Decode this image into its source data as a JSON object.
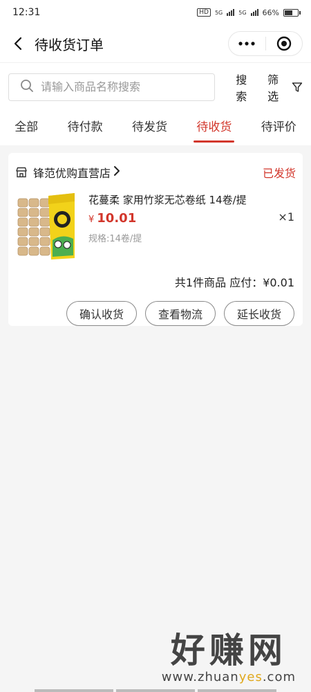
{
  "status_bar": {
    "time": "12:31",
    "network_hd": "HD",
    "signal_1": "5G",
    "signal_2": "5G",
    "battery": "66%",
    "battery_level": 0.66
  },
  "navbar": {
    "title": "待收货订单",
    "back_icon": "chevron-left-icon",
    "more_icon": "more-dots-icon",
    "close_icon": "target-circle-icon"
  },
  "search": {
    "placeholder": "请输入商品名称搜索",
    "value": "",
    "search_label": "搜索",
    "filter_label": "筛选"
  },
  "tabs": [
    {
      "label": "全部",
      "active": false
    },
    {
      "label": "待付款",
      "active": false
    },
    {
      "label": "待发货",
      "active": false
    },
    {
      "label": "待收货",
      "active": true
    },
    {
      "label": "待评价",
      "active": false
    }
  ],
  "order": {
    "shop_name": "锋范优购直营店",
    "status": "已发货",
    "product": {
      "name": "花蔓柔 家用竹浆无芯卷纸 14卷/提",
      "currency": "¥",
      "price": "10.01",
      "spec": "规格:14卷/提",
      "qty": "×1"
    },
    "summary": "共1件商品 应付：¥0.01",
    "actions": [
      "确认收货",
      "查看物流",
      "延长收货"
    ]
  },
  "watermark": {
    "main": "好赚网",
    "sub_a": "www.zhuan",
    "sub_b": "yes",
    "sub_c": ".com"
  },
  "colors": {
    "accent": "#d2362b",
    "background": "#f5f5f5"
  }
}
